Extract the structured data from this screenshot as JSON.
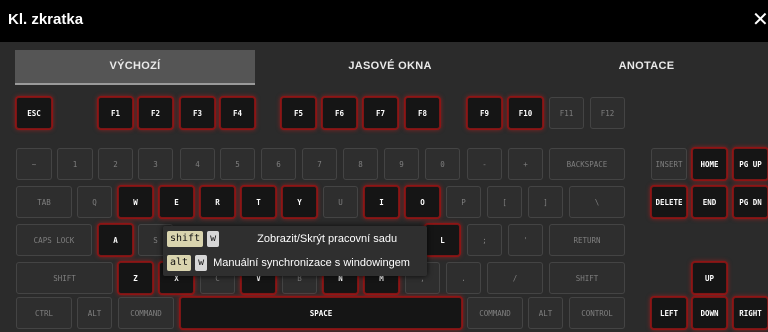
{
  "window": {
    "title": "Kl. zkratka",
    "close_glyph": "✕"
  },
  "tabs": [
    {
      "label": "VÝCHOZÍ",
      "active": true
    },
    {
      "label": "JASOVÉ OKNA",
      "active": false
    },
    {
      "label": "ANOTACE",
      "active": false
    }
  ],
  "keys": {
    "esc": "ESC",
    "f1": "F1",
    "f2": "F2",
    "f3": "F3",
    "f4": "F4",
    "f5": "F5",
    "f6": "F6",
    "f7": "F7",
    "f8": "F8",
    "f9": "F9",
    "f10": "F10",
    "f11": "F11",
    "f12": "F12",
    "tilde": "~",
    "n1": "1",
    "n2": "2",
    "n3": "3",
    "n4": "4",
    "n5": "5",
    "n6": "6",
    "n7": "7",
    "n8": "8",
    "n9": "9",
    "n0": "0",
    "minus": "-",
    "plus": "+",
    "backspace": "BACKSPACE",
    "tab": "TAB",
    "q": "Q",
    "w": "W",
    "e": "E",
    "r": "R",
    "t": "T",
    "y": "Y",
    "u": "U",
    "i": "I",
    "o": "O",
    "p": "P",
    "lbracket": "[",
    "rbracket": "]",
    "backslash": "\\",
    "caps": "CAPS LOCK",
    "a": "A",
    "s": "S",
    "l": "L",
    "semicolon": ";",
    "quote": "'",
    "return": "RETURN",
    "shift_l": "SHIFT",
    "z": "Z",
    "x": "X",
    "c": "C",
    "v": "V",
    "b": "B",
    "n": "N",
    "m": "M",
    "comma": ",",
    "period": ".",
    "slash": "/",
    "shift_r": "SHIFT",
    "ctrl": "CTRL",
    "alt_l": "ALT",
    "command_l": "COMMAND",
    "space": "SPACE",
    "command_r": "COMMAND",
    "alt_r": "ALT",
    "control": "CONTROL",
    "insert": "INSERT",
    "home": "HOME",
    "pgup": "PG UP",
    "delete": "DELETE",
    "end": "END",
    "pgdn": "PG DN",
    "up": "UP",
    "left": "LEFT",
    "down": "DOWN",
    "right": "RIGHT"
  },
  "tooltip": [
    {
      "modifier": "shift",
      "key": "w",
      "description": "Zobrazit/Skrýt pracovní sadu"
    },
    {
      "modifier": "alt",
      "key": "w",
      "description": "Manuální synchronizace s windowingem"
    }
  ],
  "colors": {
    "accent_red": "#c21e1e",
    "titlebar": "#000000",
    "background": "#2b2b2b"
  }
}
